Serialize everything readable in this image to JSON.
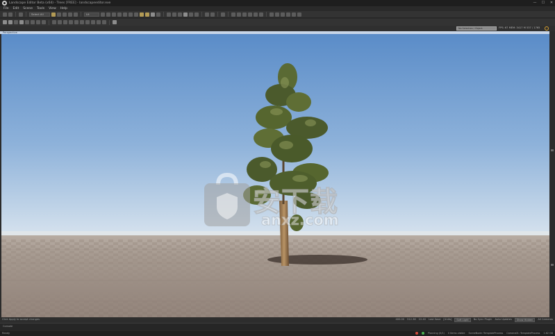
{
  "app": {
    "title": "Landscape Editor Beta (x64) - Trees [FREE] - landscapeeditor.exe",
    "window_buttons": [
      "—",
      "☐",
      "✕"
    ]
  },
  "menu": [
    "File",
    "Edit",
    "Scene",
    "Tools",
    "View",
    "Help"
  ],
  "toolbar": {
    "selection_mode": "Select All",
    "view_mode": "Lit"
  },
  "viewport": {
    "tab_label": "Perspective",
    "search_placeholder": "No Selection / Object",
    "stats": "FPS: 67   MEM: 3417 M   537 / 1765",
    "sky_top": "#5a8cc8",
    "sky_horizon": "#d6e2ee",
    "ground_color": "#a3948a"
  },
  "status": {
    "left_text": "Click Apply to accept changes",
    "cursor_x": "400.00",
    "cursor_y": "512.36",
    "zoom": "22.40",
    "mode": "Last Save",
    "units": "[Units]",
    "light": "Soft Light",
    "toggle": "No Sync Plugin",
    "extra": "Auto Updates",
    "filter": "Show Hidden",
    "cam": "All Cameras"
  },
  "panel": {
    "label": "Console"
  },
  "bottom": {
    "left_text": "Ready",
    "items": [
      "Planning (0/1)",
      "0 Items visible",
      "SceneNode: TemplateProcess",
      "Camera01: TemplateProcess",
      "1.62 GB"
    ]
  },
  "watermark": {
    "main": "安下载",
    "sub": "anxz.com"
  },
  "icons": [
    "app-logo-icon",
    "minimize-icon",
    "maximize-icon",
    "close-icon",
    "settings-icon"
  ]
}
